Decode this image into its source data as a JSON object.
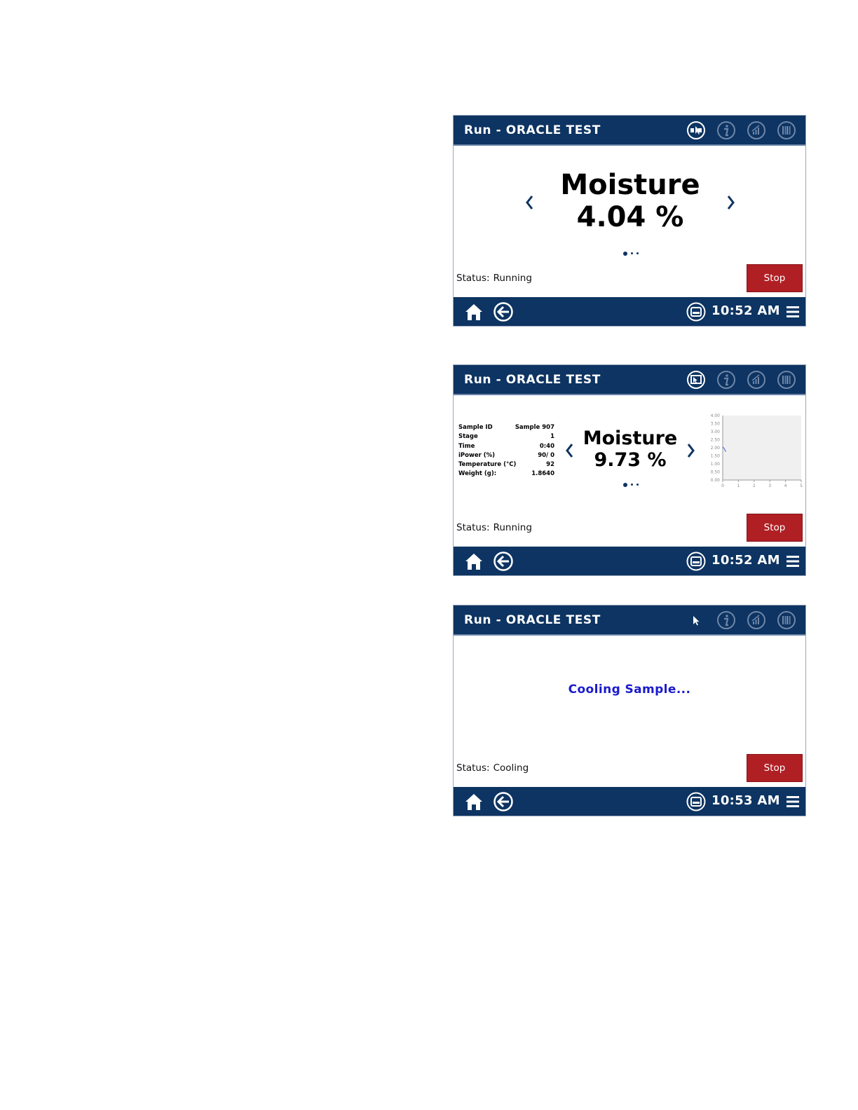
{
  "colors": {
    "header_bg": "#0d3462",
    "stop_bg": "#b01f24",
    "cooling_text": "#1a1acc"
  },
  "screens": [
    {
      "title": "Run - ORACLE TEST",
      "header_icons": [
        "view-toggle-icon",
        "info-icon",
        "chart-icon",
        "barcode-icon"
      ],
      "measure_label": "Moisture",
      "measure_value": "4.04 %",
      "status_label": "Status:",
      "status_value": "Running",
      "stop_label": "Stop",
      "clock": "10:52 AM"
    },
    {
      "title": "Run - ORACLE TEST",
      "header_icons": [
        "view-toggle-icon",
        "info-icon",
        "chart-icon",
        "barcode-icon"
      ],
      "measure_label": "Moisture",
      "measure_value": "9.73 %",
      "details": [
        {
          "label": "Sample ID",
          "value": "Sample 907"
        },
        {
          "label": "Stage",
          "value": "1"
        },
        {
          "label": "Time",
          "value": "0:40"
        },
        {
          "label": "iPower (%)",
          "value": "90/ 0"
        },
        {
          "label": "Temperature (°C)",
          "value": "92"
        },
        {
          "label": "Weight (g):",
          "value": "1.8640"
        }
      ],
      "status_label": "Status:",
      "status_value": "Running",
      "stop_label": "Stop",
      "clock": "10:52 AM"
    },
    {
      "title": "Run - ORACLE TEST",
      "header_icons": [
        "cursor-icon",
        "info-icon",
        "chart-icon",
        "barcode-icon"
      ],
      "message": "Cooling Sample...",
      "status_label": "Status:",
      "status_value": "Cooling",
      "stop_label": "Stop",
      "clock": "10:53 AM"
    }
  ],
  "chart_data": {
    "type": "line",
    "x": [
      0,
      0.1,
      0.2
    ],
    "series": [
      {
        "values": [
          2.05,
          1.95,
          1.75
        ]
      }
    ],
    "xticks": [
      "0",
      "1",
      "2",
      "3",
      "4",
      "5"
    ],
    "yticks": [
      "0.00",
      "0.50",
      "1.00",
      "1.50",
      "2.00",
      "2.50",
      "3.00",
      "3.50",
      "4.00"
    ],
    "xlim": [
      0,
      5
    ],
    "ylim": [
      0,
      4
    ],
    "grid": false,
    "title": "",
    "xlabel": "",
    "ylabel": ""
  }
}
